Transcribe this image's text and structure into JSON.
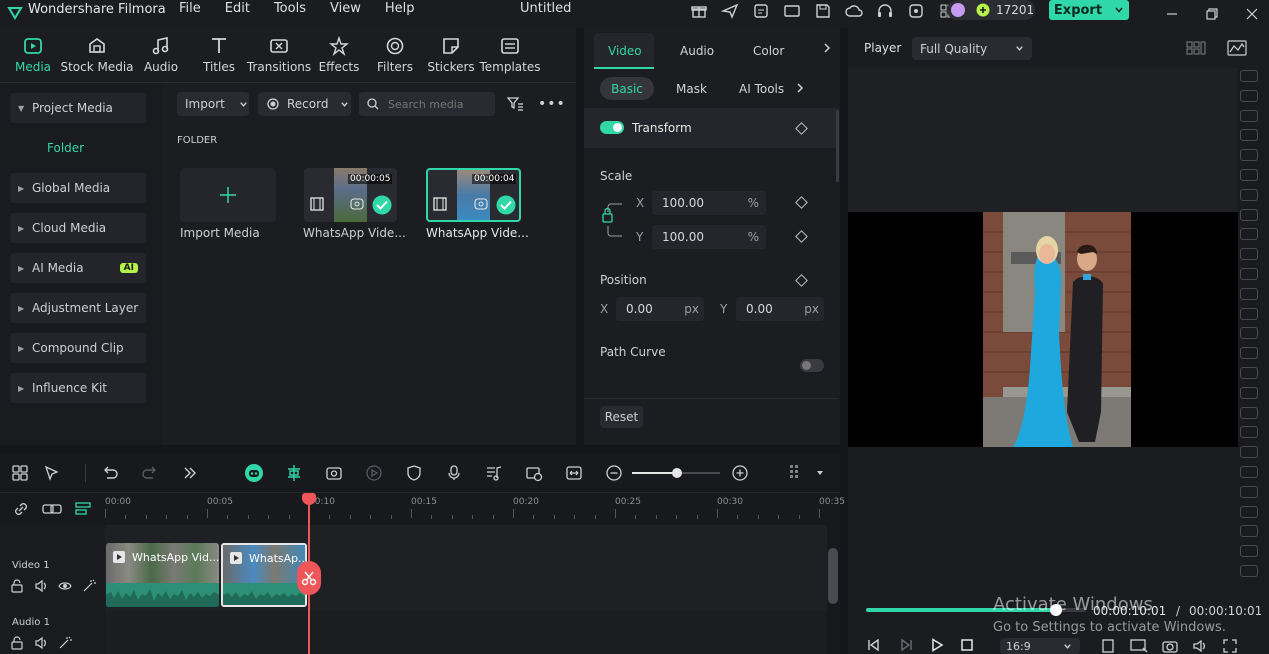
{
  "app": {
    "name": "Wondershare Filmora",
    "doc_title": "Untitled"
  },
  "menu": [
    "File",
    "Edit",
    "Tools",
    "View",
    "Help"
  ],
  "credits": "17201",
  "export_label": "Export",
  "toolbar": [
    {
      "label": "Media",
      "icon": "media-icon",
      "active": true
    },
    {
      "label": "Stock Media",
      "icon": "stock-media-icon"
    },
    {
      "label": "Audio",
      "icon": "audio-icon"
    },
    {
      "label": "Titles",
      "icon": "titles-icon"
    },
    {
      "label": "Transitions",
      "icon": "transitions-icon"
    },
    {
      "label": "Effects",
      "icon": "effects-icon"
    },
    {
      "label": "Filters",
      "icon": "filters-icon"
    },
    {
      "label": "Stickers",
      "icon": "stickers-icon"
    },
    {
      "label": "Templates",
      "icon": "templates-icon"
    }
  ],
  "sidebar": {
    "project_media": "Project Media",
    "folder": "Folder",
    "items": [
      "Global Media",
      "Cloud Media",
      "AI Media",
      "Adjustment Layer",
      "Compound Clip",
      "Influence Kit"
    ],
    "ai_badge": "AI"
  },
  "media_bar": {
    "import": "Import",
    "record": "Record",
    "search_placeholder": "Search media"
  },
  "folder_label": "FOLDER",
  "media_items": [
    {
      "label": "Import Media"
    },
    {
      "label": "WhatsApp Vide...",
      "duration": "00:00:05"
    },
    {
      "label": "WhatsApp Vide...",
      "duration": "00:00:04"
    }
  ],
  "properties": {
    "tabs": [
      "Video",
      "Audio",
      "Color"
    ],
    "subtabs": [
      "Basic",
      "Mask",
      "AI Tools"
    ],
    "transform": "Transform",
    "scale": "Scale",
    "scale_x": "100.00",
    "scale_y": "100.00",
    "percent": "%",
    "x_label": "X",
    "y_label": "Y",
    "position": "Position",
    "pos_x": "0.00",
    "pos_y": "0.00",
    "px": "px",
    "path_curve": "Path Curve",
    "reset": "Reset"
  },
  "player": {
    "label": "Player",
    "quality": "Full Quality",
    "current_time": "00:00:10:01",
    "total_time": "00:00:10:01",
    "separator": "/",
    "aspect": "16:9",
    "progress": 1.0
  },
  "watermark": {
    "line1": "Activate Windows",
    "line2": "Go to Settings to activate Windows."
  },
  "timeline": {
    "ruler": [
      "00:00",
      "00:05",
      "00:10",
      "00:15",
      "00:20",
      "00:25",
      "00:30",
      "00:35"
    ],
    "video_track": "Video 1",
    "audio_track": "Audio 1",
    "clip1": "WhatsApp Vid...",
    "clip2": "WhatsAp..."
  },
  "colors": {
    "accent": "#30d7a8",
    "playhead": "#f0555a",
    "ai_badge": "#b6f34a"
  }
}
